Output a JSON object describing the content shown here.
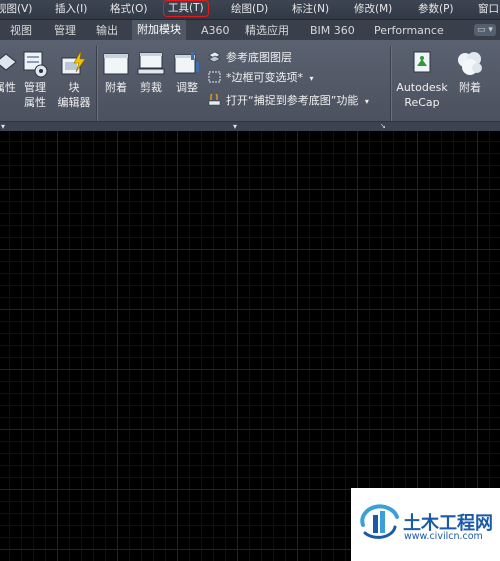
{
  "menu": {
    "items": [
      "视图(V)",
      "插入(I)",
      "格式(O)",
      "工具(T)",
      "绘图(D)",
      "标注(N)",
      "修改(M)",
      "参数(P)",
      "窗口"
    ]
  },
  "tabs": [
    "视图",
    "管理",
    "输出",
    "附加模块",
    "A360",
    "精选应用",
    "BIM 360",
    "Performance"
  ],
  "tab_options": "▭ ▾",
  "ribbon": {
    "block_panel": {
      "attr_label": "属性",
      "manage_attr_line1": "管理",
      "manage_attr_line2": "属性",
      "block_editor_line1": "块",
      "block_editor_line2": "编辑器"
    },
    "reference_panel": {
      "attach_label": "附着",
      "clip_label": "剪裁",
      "adjust_label": "调整",
      "underlay_layers_label": "参考底图图层",
      "frames_label": "*边框可变选项*",
      "snap_label": "打开“捕捉到参考底图”功能"
    },
    "recap_panel": {
      "recap_line1": "Autodesk",
      "recap_line2": "ReCap",
      "attach_label": "附着"
    }
  },
  "watermark": {
    "name": "土木工程网",
    "url": "www.civilcn.com"
  },
  "colors": {
    "menu_highlight": "#e21c1c",
    "ribbon_bg": "#535a68",
    "canvas_bg": "#000000",
    "watermark_blue": "#1a5aa8"
  }
}
